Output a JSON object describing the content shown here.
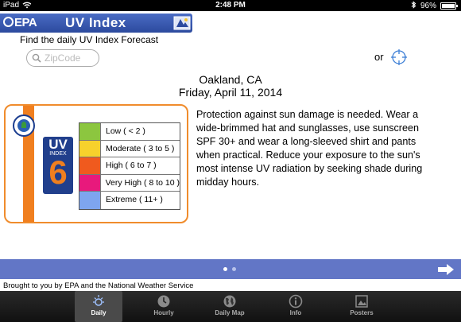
{
  "status_bar": {
    "carrier": "iPad",
    "time": "2:48 PM",
    "battery": "96%"
  },
  "header": {
    "logo_text": "EPA",
    "title": "UV Index"
  },
  "search": {
    "label": "Find the daily UV Index Forecast",
    "placeholder": "ZipCode",
    "or_label": "or"
  },
  "location": {
    "city": "Oakland, CA",
    "date": "Friday,  April 11, 2014"
  },
  "uv": {
    "badge_uv": "UV",
    "badge_index": "INDEX",
    "value": "6",
    "scale": [
      {
        "label": "Low    ( < 2 )",
        "color": "#8cc63f"
      },
      {
        "label": "Moderate   ( 3 to 5 )",
        "color": "#f7d12c"
      },
      {
        "label": "High   ( 6 to 7 )",
        "color": "#f05a1e"
      },
      {
        "label": "Very High   ( 8 to 10 )",
        "color": "#e8197c"
      },
      {
        "label": "Extreme   ( 11+ )",
        "color": "#7ea5ef"
      }
    ]
  },
  "advice": "Protection against sun damage is needed. Wear a wide-brimmed hat and sunglasses, use sunscreen SPF 30+ and wear a long-sleeved shirt and pants when practical. Reduce your exposure to the sun's most intense UV radiation by seeking shade during midday hours.",
  "pager": {
    "pages": 2,
    "current": 1
  },
  "credit": "Brought to you by EPA and the National Weather Service",
  "tabs": [
    {
      "label": "Daily",
      "icon": "sun-icon",
      "active": true
    },
    {
      "label": "Hourly",
      "icon": "clock-icon",
      "active": false
    },
    {
      "label": "Daily Map",
      "icon": "globe-icon",
      "active": false
    },
    {
      "label": "Info",
      "icon": "info-icon",
      "active": false
    },
    {
      "label": "Posters",
      "icon": "picture-icon",
      "active": false
    }
  ],
  "colors": {
    "header_blue": "#2c4a9e",
    "accent_orange": "#f07f1f",
    "pager_blue": "#6276c6",
    "badge_blue": "#213f8c"
  }
}
